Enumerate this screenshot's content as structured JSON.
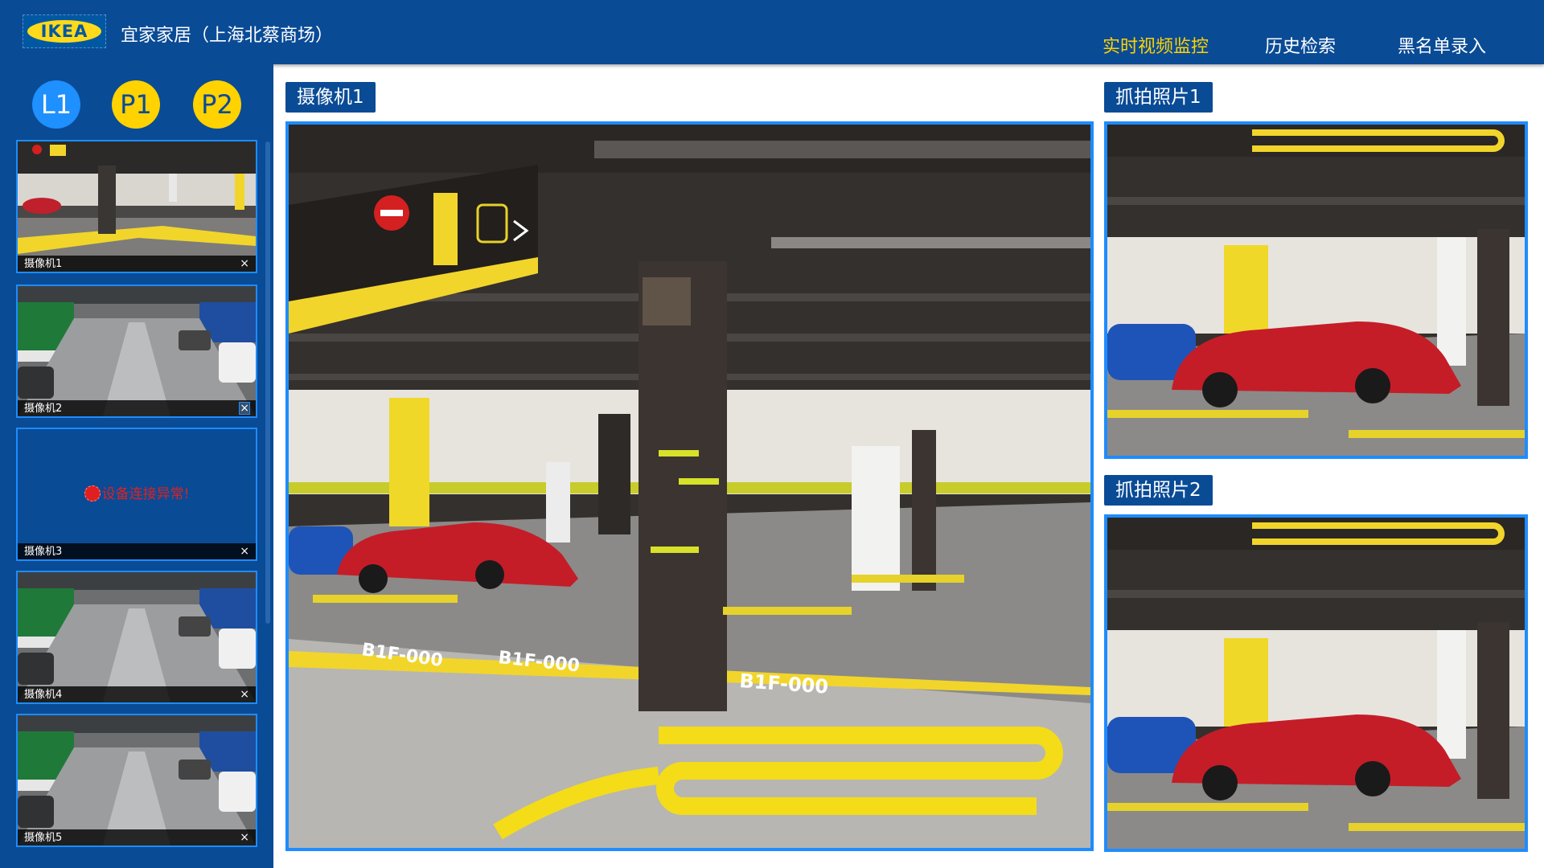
{
  "header": {
    "logo_text": "IKEA",
    "store_name": "宜家家居（上海北蔡商场）",
    "nav": [
      "实时视频监控",
      "历史检索",
      "黑名单录入"
    ],
    "active_nav": "实时视频监控"
  },
  "sidebar": {
    "floors": [
      "L1",
      "P1",
      "P2"
    ],
    "active_floor": "L1",
    "cameras": [
      {
        "label": "摄像机1",
        "close": "×",
        "scene": "parking-garage-red-car"
      },
      {
        "label": "摄像机2",
        "close": "×",
        "scene": "parking-aisle"
      },
      {
        "label": "摄像机3",
        "close": "×",
        "error": "设备连接异常!"
      },
      {
        "label": "摄像机4",
        "close": "×",
        "scene": "parking-aisle"
      },
      {
        "label": "摄像机5",
        "close": "×",
        "scene": "parking-aisle"
      }
    ]
  },
  "main": {
    "camera_title": "摄像机1",
    "snapshot1_title": "抓拍照片1",
    "snapshot2_title": "抓拍照片2",
    "floor_markings": [
      "B1F-000",
      "B1F-000",
      "B1F-000"
    ]
  },
  "colors": {
    "header_bg": "#0a4b96",
    "accent_border": "#1e8cff",
    "active_nav": "#ffd200",
    "error": "#e02020"
  }
}
